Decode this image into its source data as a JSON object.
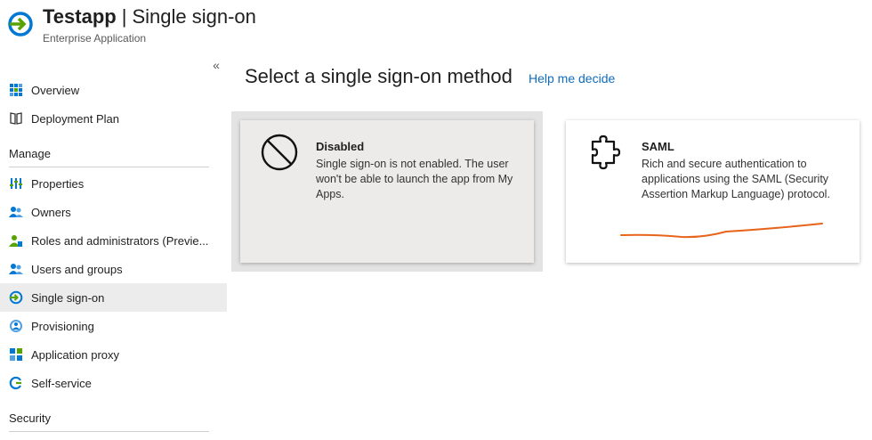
{
  "header": {
    "app_name": "Testapp",
    "separator": "|",
    "page_name": "Single sign-on",
    "subtitle": "Enterprise Application"
  },
  "sidebar": {
    "collapse_glyph": "«",
    "items_top": [
      {
        "label": "Overview",
        "icon": "overview-grid-icon"
      },
      {
        "label": "Deployment Plan",
        "icon": "book-icon"
      }
    ],
    "manage_header": "Manage",
    "manage_items": [
      {
        "label": "Properties",
        "icon": "properties-bars-icon"
      },
      {
        "label": "Owners",
        "icon": "users-icon"
      },
      {
        "label": "Roles and administrators (Previe...",
        "icon": "role-icon"
      },
      {
        "label": "Users and groups",
        "icon": "users-icon"
      },
      {
        "label": "Single sign-on",
        "icon": "sso-arrow-icon",
        "active": true
      },
      {
        "label": "Provisioning",
        "icon": "provisioning-icon"
      },
      {
        "label": "Application proxy",
        "icon": "app-proxy-icon"
      },
      {
        "label": "Self-service",
        "icon": "self-service-icon"
      }
    ],
    "security_header": "Security"
  },
  "main": {
    "heading": "Select a single sign-on method",
    "help_link": "Help me decide",
    "cards": [
      {
        "title": "Disabled",
        "description": "Single sign-on is not enabled. The user won't be able to launch the app from My Apps.",
        "icon": "disabled-circle-icon",
        "selected": true
      },
      {
        "title": "SAML",
        "description": "Rich and secure authentication to applications using the SAML (Security Assertion Markup Language) protocol.",
        "icon": "puzzle-piece-icon",
        "selected": false
      }
    ]
  },
  "colors": {
    "accent_link": "#0f6cbd",
    "active_nav_bg": "#ececec",
    "annotation_stroke": "#e8641b",
    "sso_icon_blue": "#0078d4",
    "sso_icon_green": "#57a300"
  }
}
